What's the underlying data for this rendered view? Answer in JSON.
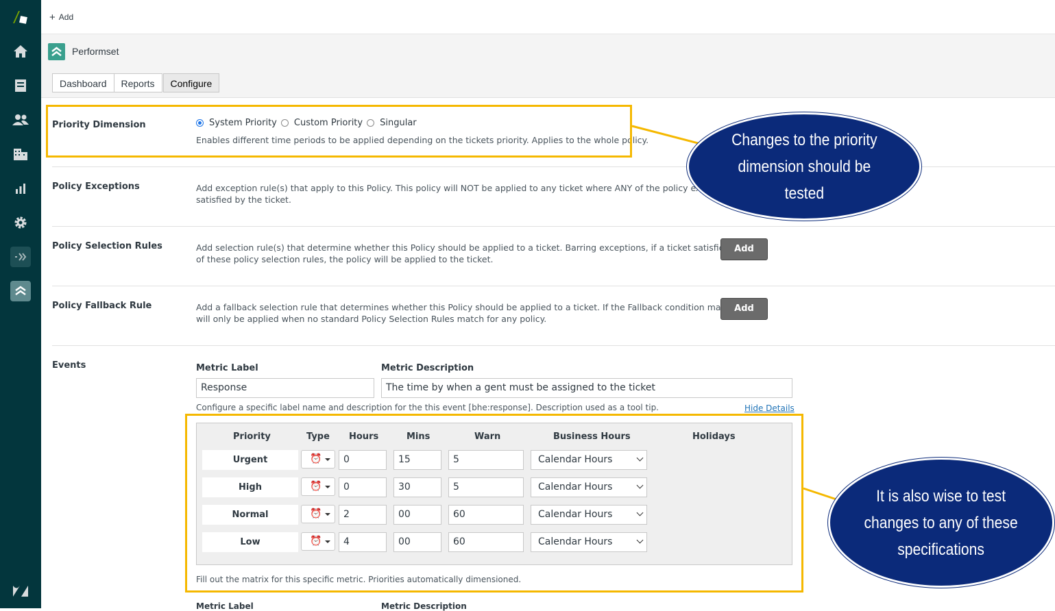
{
  "topbar": {
    "add_label": "Add"
  },
  "app": {
    "name": "Performset"
  },
  "tabs": [
    {
      "label": "Dashboard"
    },
    {
      "label": "Reports"
    },
    {
      "label": "Configure"
    }
  ],
  "priority_dimension": {
    "label": "Priority Dimension",
    "options": [
      {
        "label": "System Priority",
        "checked": true
      },
      {
        "label": "Custom Priority",
        "checked": false
      },
      {
        "label": "Singular",
        "checked": false
      }
    ],
    "description": "Enables different time periods to be applied depending on the tickets priority. Applies to the whole policy."
  },
  "policy_exceptions": {
    "label": "Policy Exceptions",
    "description_line1": "Add exception rule(s) that apply to this Policy. This policy will NOT be applied to any ticket where ANY of the policy exceptions are",
    "description_line2": "satisfied by the ticket."
  },
  "policy_selection": {
    "label": "Policy Selection Rules",
    "description_line1": "Add selection rule(s) that determine whether this Policy should be applied to a ticket. Barring exceptions, if a ticket satisfies ANY",
    "description_line2": "of these policy selection rules, the policy will be applied to the ticket.",
    "button": "Add"
  },
  "policy_fallback": {
    "label": "Policy Fallback Rule",
    "description_line1": "Add a fallback selection rule that determines whether this Policy should be applied to a ticket. If the Fallback condition matches, it",
    "description_line2": "will only be applied when no standard Policy Selection Rules match for any policy.",
    "button": "Add"
  },
  "events": {
    "label": "Events",
    "metric_label_title": "Metric Label",
    "metric_label_value": "Response",
    "metric_desc_title": "Metric Description",
    "metric_desc_value": "The time by when a gent must be assigned to the ticket",
    "hint": "Configure a specific label name and description for the this event [bhe:response]. Description used as a tool tip.",
    "hide_details": "Hide Details",
    "matrix_headers": [
      "Priority",
      "Type",
      "Hours",
      "Mins",
      "Warn",
      "Business Hours",
      "Holidays"
    ],
    "rows": [
      {
        "priority": "Urgent",
        "hours": "0",
        "mins": "15",
        "warn": "5",
        "business_hours": "Calendar Hours"
      },
      {
        "priority": "High",
        "hours": "0",
        "mins": "30",
        "warn": "5",
        "business_hours": "Calendar Hours"
      },
      {
        "priority": "Normal",
        "hours": "2",
        "mins": "00",
        "warn": "60",
        "business_hours": "Calendar Hours"
      },
      {
        "priority": "Low",
        "hours": "4",
        "mins": "00",
        "warn": "60",
        "business_hours": "Calendar Hours"
      }
    ],
    "matrix_hint": "Fill out the matrix for this specific metric. Priorities automatically dimensioned.",
    "next_metric_label_title": "Metric Label",
    "next_metric_desc_title": "Metric Description"
  },
  "callouts": {
    "top": "Changes to the priority dimension should be tested",
    "bottom": "It is also wise to test changes to any of these specifications"
  },
  "colors": {
    "sidebar": "#03363d",
    "highlight": "#f5b800",
    "callout": "#0b2a7a"
  }
}
